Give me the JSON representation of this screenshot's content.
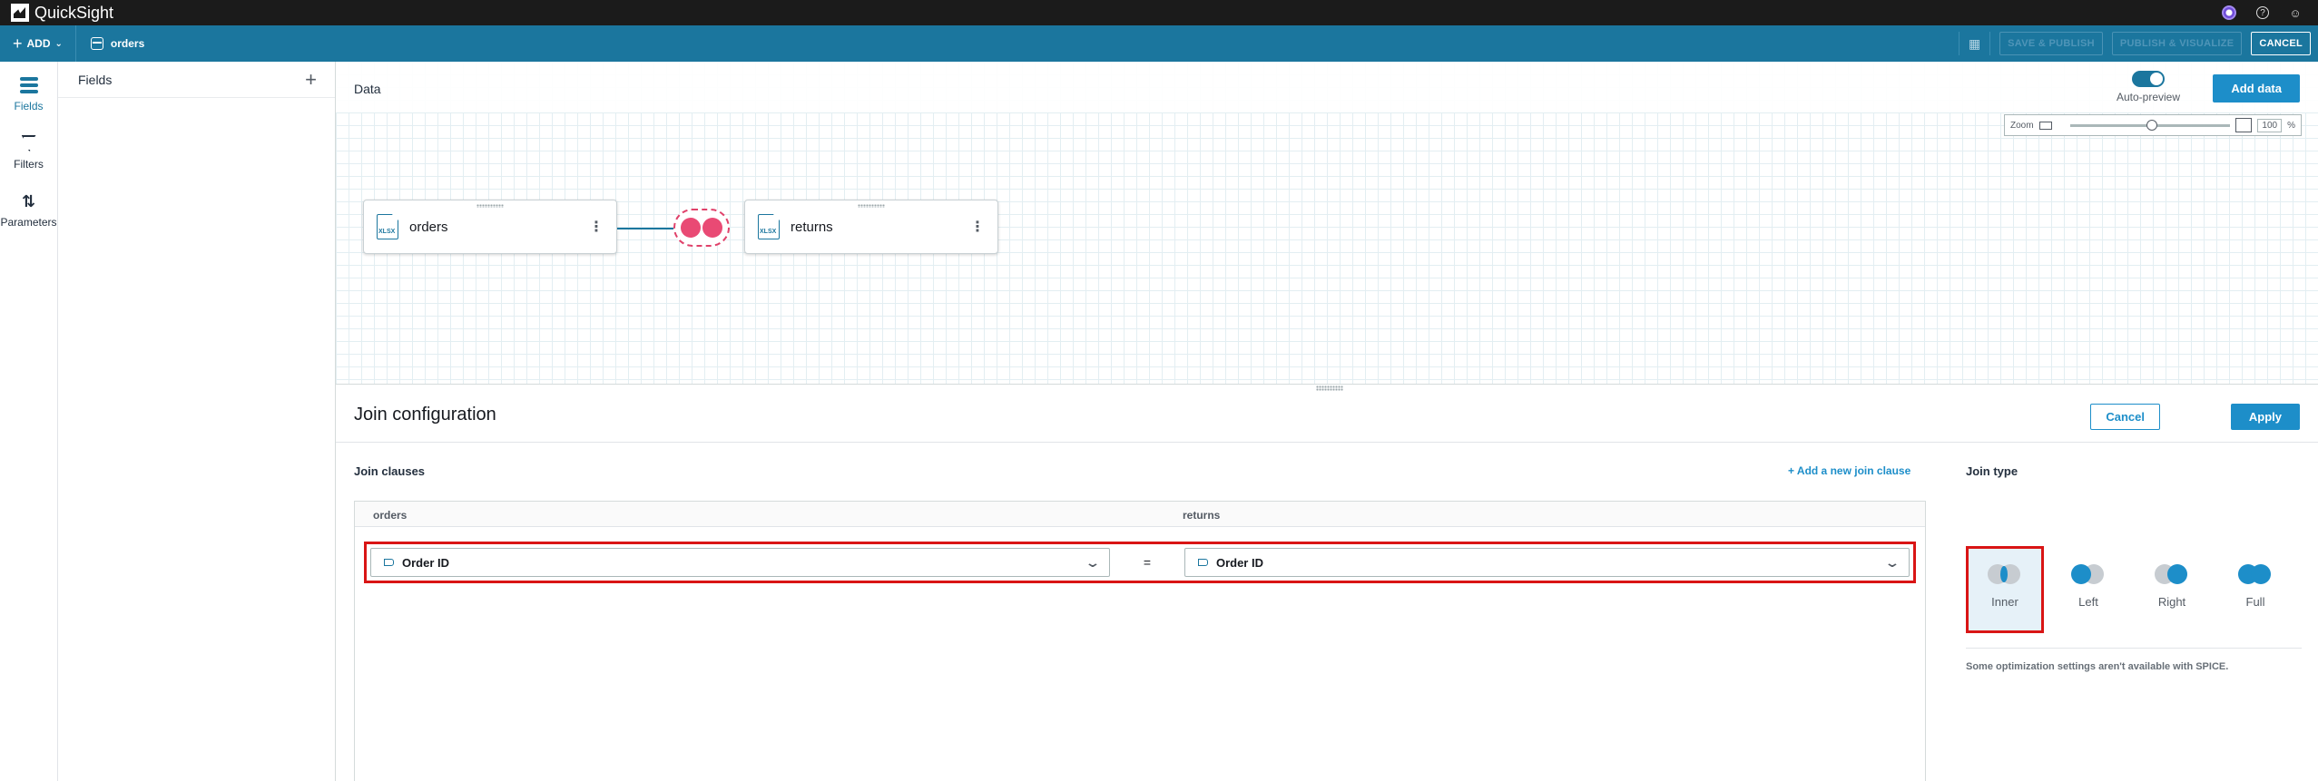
{
  "topbar": {
    "app_name": "QuickSight"
  },
  "toolbar": {
    "add_label": "ADD",
    "dataset_name": "orders",
    "save_publish": "SAVE & PUBLISH",
    "publish_visualize": "PUBLISH & VISUALIZE",
    "cancel": "CANCEL"
  },
  "rail": [
    {
      "label": "Fields",
      "icon": "stack-icon"
    },
    {
      "label": "Filters",
      "icon": "funnel-icon"
    },
    {
      "label": "Parameters",
      "icon": "sliders-icon"
    }
  ],
  "fields_panel": {
    "title": "Fields"
  },
  "canvas": {
    "title": "Data",
    "auto_preview": "Auto-preview",
    "auto_preview_on": true,
    "add_data": "Add data",
    "zoom_label": "Zoom",
    "zoom_value": "100",
    "zoom_unit": "%",
    "nodes": [
      {
        "name": "orders",
        "badge": "XLSX"
      },
      {
        "name": "returns",
        "badge": "XLSX"
      }
    ]
  },
  "join": {
    "title": "Join configuration",
    "cancel": "Cancel",
    "apply": "Apply",
    "clauses_label": "Join clauses",
    "add_clause": "+ Add a new join clause",
    "left_table": "orders",
    "right_table": "returns",
    "left_field": "Order ID",
    "operator": "=",
    "right_field": "Order ID",
    "type_label": "Join type",
    "types": [
      "Inner",
      "Left",
      "Right",
      "Full"
    ],
    "selected_type": "Inner",
    "note": "Some optimization settings aren't available with SPICE."
  },
  "colors": {
    "accent": "#1d8ec9",
    "toolbar": "#1b769e",
    "join_icon": "#e94a74",
    "highlight": "#d91515"
  }
}
